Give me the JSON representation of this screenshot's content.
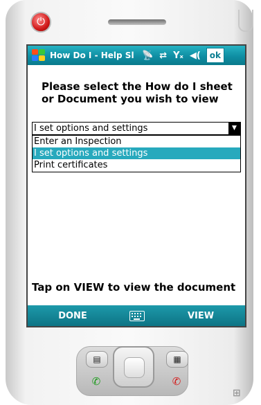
{
  "titlebar": {
    "title": "How Do I - Help Sl",
    "icons": [
      "connectivity-icon",
      "sync-icon",
      "signal-icon",
      "volume-icon"
    ],
    "ok_label": "ok"
  },
  "prompt": "Please select the How do I sheet or Document you wish to view",
  "combo": {
    "value": "I set options and settings",
    "options": [
      "Enter an Inspection",
      "I set options and settings",
      "Print certificates"
    ],
    "selected_index": 1
  },
  "footer_text": "Tap on VIEW to view the document",
  "softkeys": {
    "left": "DONE",
    "right": "VIEW"
  },
  "colors": {
    "accent": "#1a9fb2",
    "selected": "#27a9bd"
  }
}
